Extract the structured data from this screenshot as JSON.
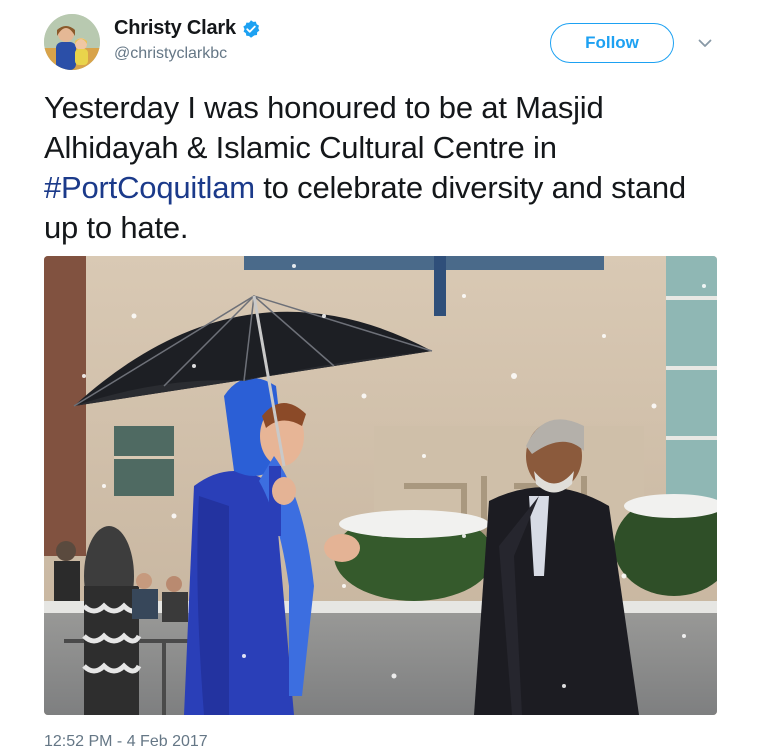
{
  "author": {
    "display_name": "Christy Clark",
    "handle": "@christyclarkbc",
    "verified": true,
    "avatar_icon": "profile-photo-avatar"
  },
  "actions": {
    "follow_label": "Follow",
    "more_icon": "chevron-down-icon"
  },
  "tweet": {
    "text_before": "Yesterday I was honoured to be at Masjid Alhidayah & Islamic Cultural Centre in ",
    "hashtag": "#PortCoquitlam",
    "text_after": " to celebrate diversity and stand up to hate.",
    "timestamp": "12:52 PM - 4 Feb 2017"
  },
  "colors": {
    "accent": "#1da1f2",
    "hashtag": "#1b3a8a",
    "secondary_text": "#657786"
  }
}
